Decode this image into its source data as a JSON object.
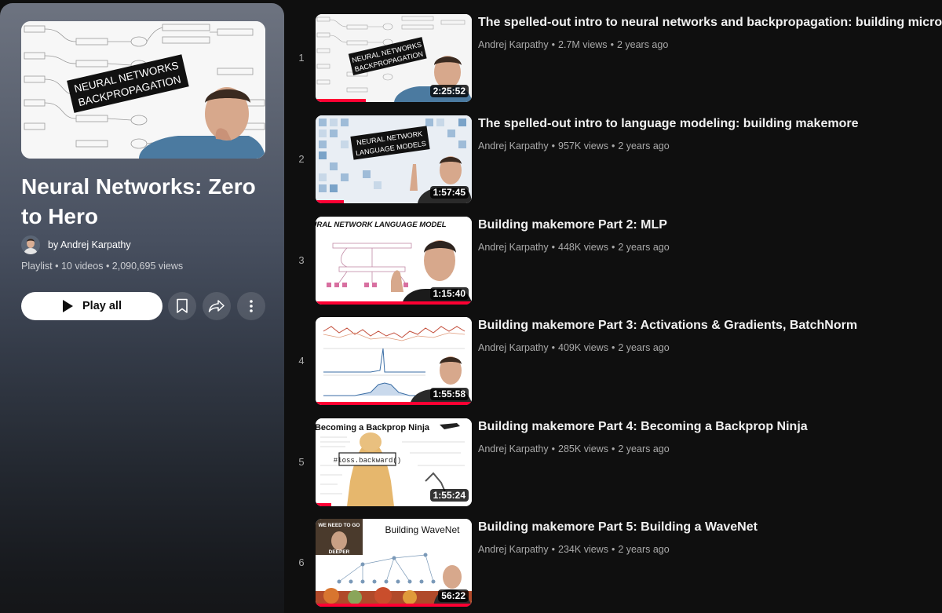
{
  "playlist": {
    "thumbnail_caption": [
      "NEURAL NETWORKS",
      "BACKPROPAGATION"
    ],
    "title": "Neural Networks: Zero to Hero",
    "owner": "by Andrej Karpathy",
    "type": "Playlist",
    "video_count": "10 videos",
    "views": "2,090,695 views",
    "play_all_label": "Play all",
    "save_icon": "bookmark-icon",
    "share_icon": "share-icon",
    "more_icon": "more-vert-icon"
  },
  "videos": [
    {
      "index": "1",
      "title": "The spelled-out intro to neural networks and backpropagation: building micrograd",
      "channel": "Andrej Karpathy",
      "views": "2.7M views",
      "age": "2 years ago",
      "duration": "2:25:52",
      "thumb_caption": [
        "NEURAL NETWORKS",
        "BACKPROPAGATION"
      ],
      "watched_fraction": 0.32
    },
    {
      "index": "2",
      "title": "The spelled-out intro to language modeling: building makemore",
      "channel": "Andrej Karpathy",
      "views": "957K views",
      "age": "2 years ago",
      "duration": "1:57:45",
      "thumb_caption": [
        "NEURAL NETWORK",
        "LANGUAGE MODELS"
      ],
      "watched_fraction": 0.18
    },
    {
      "index": "3",
      "title": "Building makemore Part 2: MLP",
      "channel": "Andrej Karpathy",
      "views": "448K views",
      "age": "2 years ago",
      "duration": "1:15:40",
      "thumb_caption": [
        "NEURAL NETWORK LANGUAGE MODEL"
      ],
      "watched_fraction": 1.0
    },
    {
      "index": "4",
      "title": "Building makemore Part 3: Activations & Gradients, BatchNorm",
      "channel": "Andrej Karpathy",
      "views": "409K views",
      "age": "2 years ago",
      "duration": "1:55:58",
      "thumb_caption": [],
      "watched_fraction": 1.0
    },
    {
      "index": "5",
      "title": "Building makemore Part 4: Becoming a Backprop Ninja",
      "channel": "Andrej Karpathy",
      "views": "285K views",
      "age": "2 years ago",
      "duration": "1:55:24",
      "thumb_caption": [
        "Becoming a Backprop Ninja",
        "#loss.backward()"
      ],
      "watched_fraction": 0.1
    },
    {
      "index": "6",
      "title": "Building makemore Part 5: Building a WaveNet",
      "channel": "Andrej Karpathy",
      "views": "234K views",
      "age": "2 years ago",
      "duration": "56:22",
      "thumb_caption": [
        "Building WaveNet",
        "WE NEED TO GO",
        "DEEPER"
      ],
      "watched_fraction": 1.0
    }
  ],
  "colors": {
    "background": "#0f0f0f",
    "progress": "#ff0033",
    "meta_text": "#aaaaaa"
  }
}
